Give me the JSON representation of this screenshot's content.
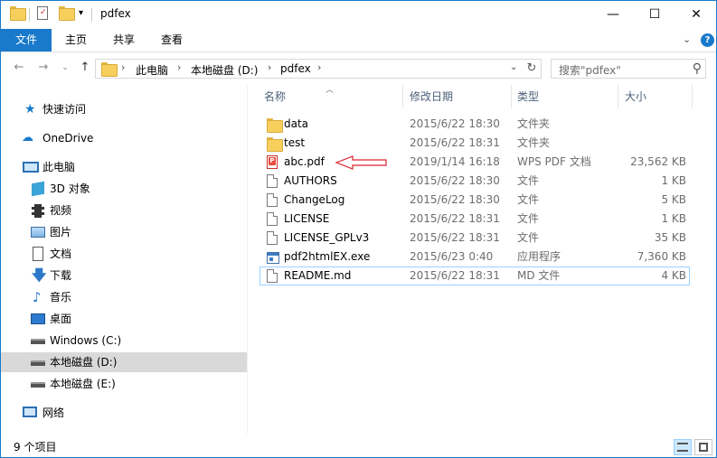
{
  "window": {
    "title": "pdfex",
    "controls": {
      "minimize": "—",
      "maximize": "☐",
      "close": "✕"
    }
  },
  "ribbon": {
    "tabs": [
      "文件",
      "主页",
      "共享",
      "查看"
    ],
    "expand_icon": "chevron-down",
    "help_label": "?"
  },
  "address": {
    "segments": [
      "此电脑",
      "本地磁盘 (D:)",
      "pdfex"
    ],
    "search_placeholder": "搜索\"pdfex\""
  },
  "nav": {
    "quick_access": "快速访问",
    "onedrive": "OneDrive",
    "this_pc": "此电脑",
    "items": [
      {
        "label": "3D 对象",
        "icon": "cube-icon"
      },
      {
        "label": "视频",
        "icon": "video-icon"
      },
      {
        "label": "图片",
        "icon": "picture-icon"
      },
      {
        "label": "文档",
        "icon": "document-icon"
      },
      {
        "label": "下载",
        "icon": "download-icon"
      },
      {
        "label": "音乐",
        "icon": "music-icon"
      },
      {
        "label": "桌面",
        "icon": "desktop-icon"
      },
      {
        "label": "Windows (C:)",
        "icon": "drive-icon"
      },
      {
        "label": "本地磁盘 (D:)",
        "icon": "drive-icon",
        "selected": true
      },
      {
        "label": "本地磁盘 (E:)",
        "icon": "drive-icon"
      }
    ],
    "network": "网络"
  },
  "list": {
    "columns": [
      "名称",
      "修改日期",
      "类型",
      "大小"
    ],
    "rows": [
      {
        "name": "data",
        "date": "2015/6/22 18:30",
        "type": "文件夹",
        "size": "",
        "icon": "folder"
      },
      {
        "name": "test",
        "date": "2015/6/22 18:31",
        "type": "文件夹",
        "size": "",
        "icon": "folder"
      },
      {
        "name": "abc.pdf",
        "date": "2019/1/14 16:18",
        "type": "WPS PDF 文档",
        "size": "23,562 KB",
        "icon": "pdf"
      },
      {
        "name": "AUTHORS",
        "date": "2015/6/22 18:30",
        "type": "文件",
        "size": "1 KB",
        "icon": "file"
      },
      {
        "name": "ChangeLog",
        "date": "2015/6/22 18:30",
        "type": "文件",
        "size": "5 KB",
        "icon": "file"
      },
      {
        "name": "LICENSE",
        "date": "2015/6/22 18:31",
        "type": "文件",
        "size": "1 KB",
        "icon": "file"
      },
      {
        "name": "LICENSE_GPLv3",
        "date": "2015/6/22 18:31",
        "type": "文件",
        "size": "35 KB",
        "icon": "file"
      },
      {
        "name": "pdf2htmlEX.exe",
        "date": "2015/6/23 0:40",
        "type": "应用程序",
        "size": "7,360 KB",
        "icon": "exe"
      },
      {
        "name": "README.md",
        "date": "2015/6/22 18:31",
        "type": "MD 文件",
        "size": "4 KB",
        "icon": "file",
        "focused": true
      }
    ]
  },
  "annotation": {
    "arrow_color": "#d9232e"
  },
  "status": {
    "item_count": "9 个项目"
  },
  "colors": {
    "accent": "#1979ca",
    "selection": "#d9d9d9",
    "folder": "#f7cf5d"
  }
}
